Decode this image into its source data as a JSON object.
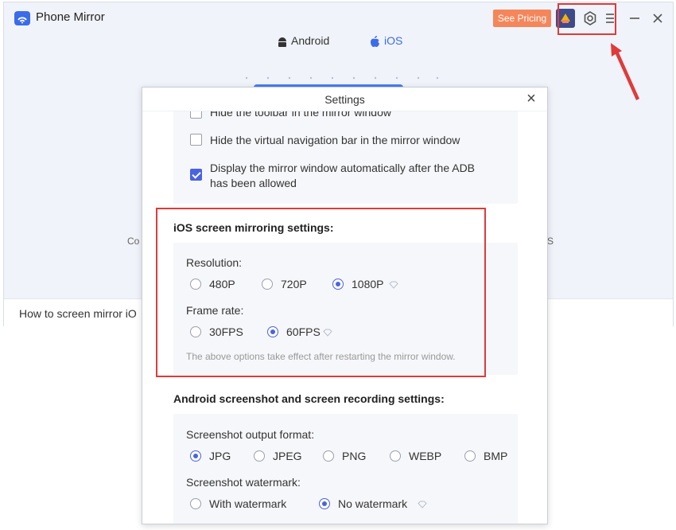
{
  "app": {
    "title": "Phone Mirror",
    "pricing_label": "See Pricing",
    "platforms": [
      {
        "label": "Android",
        "icon": "android-icon"
      },
      {
        "label": "iOS",
        "icon": "apple-icon"
      }
    ],
    "bottom_text": "How to screen mirror iO",
    "left_fragment": "Co",
    "right_fragment": "S"
  },
  "dialog": {
    "title": "Settings",
    "general_options": [
      {
        "label": "Hide the toolbar in the mirror window",
        "checked": false
      },
      {
        "label": "Hide the virtual navigation bar in the mirror window",
        "checked": false
      },
      {
        "label": "Display the mirror window automatically after the ADB",
        "label2": "has been allowed",
        "checked": true
      }
    ],
    "ios_section": {
      "heading": "iOS screen mirroring settings:",
      "resolution_label": "Resolution:",
      "resolutions": [
        "480P",
        "720P",
        "1080P"
      ],
      "resolution_selected": "1080P",
      "frame_rate_label": "Frame rate:",
      "frame_rates": [
        "30FPS",
        "60FPS"
      ],
      "frame_rate_selected": "60FPS",
      "note": "The above options take effect after restarting the mirror window."
    },
    "android_section": {
      "heading": "Android screenshot and screen recording settings:",
      "format_label": "Screenshot output format:",
      "formats": [
        "JPG",
        "JPEG",
        "PNG",
        "WEBP",
        "BMP"
      ],
      "format_selected": "JPG",
      "watermark_label": "Screenshot watermark:",
      "watermarks": [
        "With watermark",
        "No watermark"
      ],
      "watermark_selected": "No watermark"
    }
  },
  "colors": {
    "accent": "#4a63e0",
    "pricing": "#f5865b",
    "annotation": "#e03a3a"
  }
}
